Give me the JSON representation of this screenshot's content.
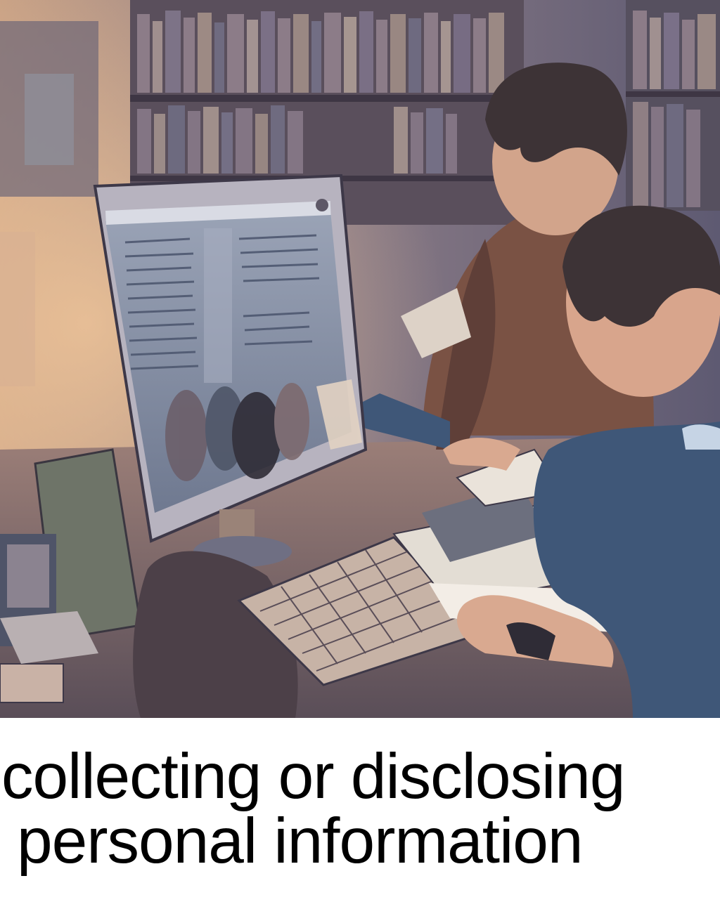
{
  "image": {
    "description_icons": [
      "monitor-icon",
      "keyboard-icon",
      "bookshelf-icon",
      "person-icon",
      "document-icon"
    ],
    "palette": {
      "background_warm": "#c49a7e",
      "background_cool": "#6f6e86",
      "wall_dark": "#4b4454",
      "monitor_frame": "#b7b3bf",
      "screen": "#8a94ab",
      "jacket_brown": "#7a5244",
      "shirt_blue": "#3f5778",
      "skin": "#d9a990",
      "hair": "#3d3336"
    }
  },
  "caption": {
    "line1": "collecting or disclosing",
    "line2": "personal information"
  }
}
